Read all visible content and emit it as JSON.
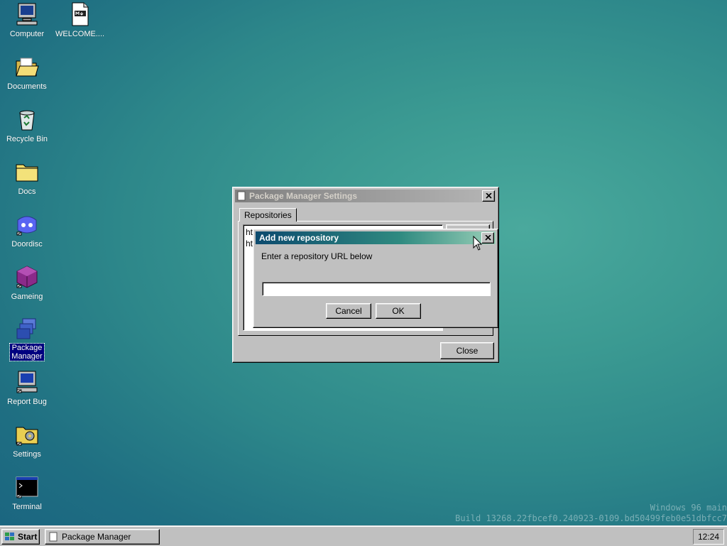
{
  "desktop": {
    "icons": [
      {
        "label": "Computer",
        "icon": "computer-icon"
      },
      {
        "label": "WELCOME....",
        "icon": "markdown-file-icon"
      },
      {
        "label": "Documents",
        "icon": "open-folder-icon"
      },
      {
        "label": "Recycle Bin",
        "icon": "recycle-bin-icon"
      },
      {
        "label": "Docs",
        "icon": "folder-icon"
      },
      {
        "label": "Doordisc",
        "icon": "doordisc-icon"
      },
      {
        "label": "Gameing",
        "icon": "cube-icon"
      },
      {
        "label": "Package",
        "label2": "Manager",
        "icon": "package-manager-icon"
      },
      {
        "label": "Report Bug",
        "icon": "computer-bug-icon"
      },
      {
        "label": "Settings",
        "icon": "settings-folder-icon"
      },
      {
        "label": "Terminal",
        "icon": "terminal-icon"
      }
    ],
    "watermark": {
      "line1": "Windows 96 main",
      "line2": "Build 13268.22fbcef0.240923-0109.bd50499feb0e51dbfcc7"
    }
  },
  "settings_window": {
    "title": "Package Manager Settings",
    "tab": "Repositories",
    "list_items": [
      "htt",
      "htt"
    ],
    "close_label": "Close"
  },
  "dialog": {
    "title": "Add new repository",
    "prompt": "Enter a repository URL below",
    "input_value": "",
    "cancel_label": "Cancel",
    "ok_label": "OK"
  },
  "taskbar": {
    "start_label": "Start",
    "task_label": "Package Manager",
    "clock": "12:24"
  },
  "colors": {
    "desktop_teal": "#2d878a",
    "title_active": "#0c4a6e",
    "selection_navy": "#000080",
    "face_gray": "#c0c0c0"
  }
}
